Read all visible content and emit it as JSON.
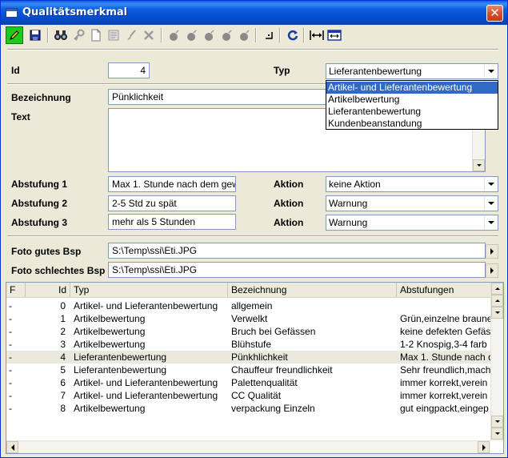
{
  "window": {
    "title": "Qualitätsmerkmal",
    "close_glyph": "✕"
  },
  "toolbar": {
    "buttons": [
      {
        "icon": "pencil-icon"
      },
      {
        "icon": "save-icon"
      },
      {
        "icon": "binoculars-icon"
      },
      {
        "icon": "key-icon"
      },
      {
        "icon": "new-document-icon"
      },
      {
        "icon": "form-icon"
      },
      {
        "icon": "brush-icon"
      },
      {
        "icon": "delete-icon"
      },
      {
        "icon": "bomb-icon"
      },
      {
        "icon": "bomb-icon"
      },
      {
        "icon": "bomb-icon"
      },
      {
        "icon": "bomb-icon"
      },
      {
        "icon": "bomb-icon"
      },
      {
        "icon": "bracket-icon"
      },
      {
        "icon": "refresh-icon"
      },
      {
        "icon": "arrows-icon"
      },
      {
        "icon": "screen-icon"
      }
    ]
  },
  "form": {
    "id_label": "Id",
    "id_value": "4",
    "typ_label": "Typ",
    "typ_value": "Lieferantenbewertung",
    "typ_options": [
      "Artikel- und Lieferantenbewertung",
      "Artikelbewertung",
      "Lieferantenbewertung",
      "Kundenbeanstandung"
    ],
    "typ_highlighted": "Artikel- und Lieferantenbewertung",
    "bezeichnung_label": "Bezeichnung",
    "bezeichnung_value": "Pünklichkeit",
    "text_label": "Text",
    "text_value": "",
    "abstufung1_label": "Abstufung 1",
    "abstufung1_value": "Max 1. Stunde nach dem gew",
    "abstufung2_label": "Abstufung 2",
    "abstufung2_value": "2-5 Std zu spät",
    "abstufung3_label": "Abstufung 3",
    "abstufung3_value": "mehr als 5 Stunden",
    "aktion_label": "Aktion",
    "aktion1_value": "keine Aktion",
    "aktion2_value": "Warnung",
    "aktion3_value": "Warnung",
    "foto_gut_label": "Foto gutes Bsp",
    "foto_gut_value": "S:\\Temp\\ssi\\Eti.JPG",
    "foto_schlecht_label": "Foto schlechtes Bsp",
    "foto_schlecht_value": "S:\\Temp\\ssi\\Eti.JPG"
  },
  "grid": {
    "columns": [
      "F",
      "Id",
      "Typ",
      "Bezeichnung",
      "Abstufungen"
    ],
    "rows": [
      {
        "f": "-",
        "id": "0",
        "typ": "Artikel- und Lieferantenbewertung",
        "bez": "allgemein",
        "abst": ""
      },
      {
        "f": "-",
        "id": "1",
        "typ": "Artikelbewertung",
        "bez": "Verwelkt",
        "abst": "Grün,einzelne braune"
      },
      {
        "f": "-",
        "id": "2",
        "typ": "Artikelbewertung",
        "bez": "Bruch bei Gefässen",
        "abst": "keine defekten Gefäss"
      },
      {
        "f": "-",
        "id": "3",
        "typ": "Artikelbewertung",
        "bez": "Blühstufe",
        "abst": "1-2 Knospig,3-4 farb"
      },
      {
        "f": "-",
        "id": "4",
        "typ": "Lieferantenbewertung",
        "bez": "Pünkhlichkeit",
        "abst": "Max 1. Stunde nach d"
      },
      {
        "f": "-",
        "id": "5",
        "typ": "Lieferantenbewertung",
        "bez": "Chauffeur freundlichkeit",
        "abst": "Sehr freundlich,mach"
      },
      {
        "f": "-",
        "id": "6",
        "typ": "Artikel- und Lieferantenbewertung",
        "bez": "Palettenqualität",
        "abst": "immer korrekt,verein"
      },
      {
        "f": "-",
        "id": "7",
        "typ": "Artikel- und Lieferantenbewertung",
        "bez": "CC Qualität",
        "abst": "immer korrekt,verein"
      },
      {
        "f": "-",
        "id": "8",
        "typ": "Artikelbewertung",
        "bez": "verpackung Einzeln",
        "abst": "gut eingpackt,eingep"
      }
    ],
    "selected_row": 4
  }
}
